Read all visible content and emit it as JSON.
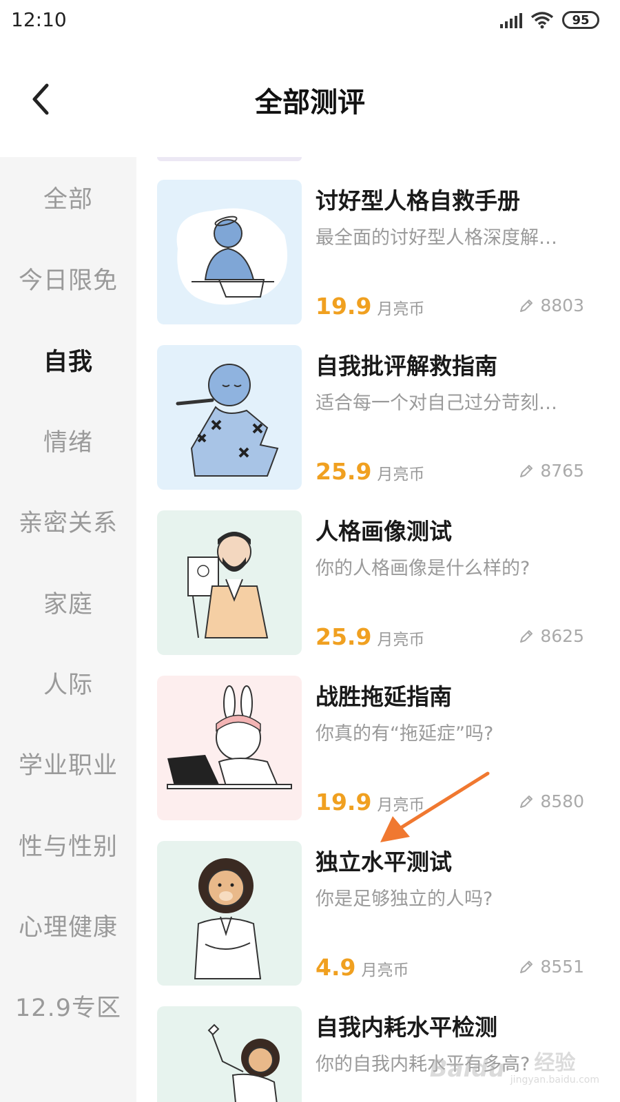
{
  "status": {
    "time": "12:10",
    "battery": "95"
  },
  "header": {
    "title": "全部测评"
  },
  "sidebar": {
    "items": [
      {
        "label": "全部"
      },
      {
        "label": "今日限免"
      },
      {
        "label": "自我",
        "active": true
      },
      {
        "label": "情绪"
      },
      {
        "label": "亲密关系"
      },
      {
        "label": "家庭"
      },
      {
        "label": "人际"
      },
      {
        "label": "学业职业"
      },
      {
        "label": "性与性别"
      },
      {
        "label": "心理健康"
      },
      {
        "label": "12.9专区"
      }
    ]
  },
  "list": {
    "price_unit": "月亮币",
    "cards": [
      {
        "title": "讨好型人格自救手册",
        "desc": "最全面的讨好型人格深度解…",
        "price": "19.9",
        "count": "8803",
        "bg": "#e3f1fb"
      },
      {
        "title": "自我批评解救指南",
        "desc": "适合每一个对自己过分苛刻…",
        "price": "25.9",
        "count": "8765",
        "bg": "#e3f1fb"
      },
      {
        "title": "人格画像测试",
        "desc": "你的人格画像是什么样的?",
        "price": "25.9",
        "count": "8625",
        "bg": "#e7f3ee"
      },
      {
        "title": "战胜拖延指南",
        "desc": "你真的有“拖延症”吗?",
        "price": "19.9",
        "count": "8580",
        "bg": "#fdeeee"
      },
      {
        "title": "独立水平测试",
        "desc": "你是足够独立的人吗?",
        "price": "4.9",
        "count": "8551",
        "bg": "#e7f3ee"
      },
      {
        "title": "自我内耗水平检测",
        "desc": "你的自我内耗水平有多高?",
        "price": "",
        "count": "",
        "bg": "#e7f3ee"
      }
    ]
  },
  "watermark": {
    "logo": "Baidu",
    "main": "经验",
    "sub": "jingyan.baidu.com"
  },
  "colors": {
    "price": "#f0a020",
    "sidebar_bg": "#f5f5f5",
    "arrow": "#f07830"
  }
}
